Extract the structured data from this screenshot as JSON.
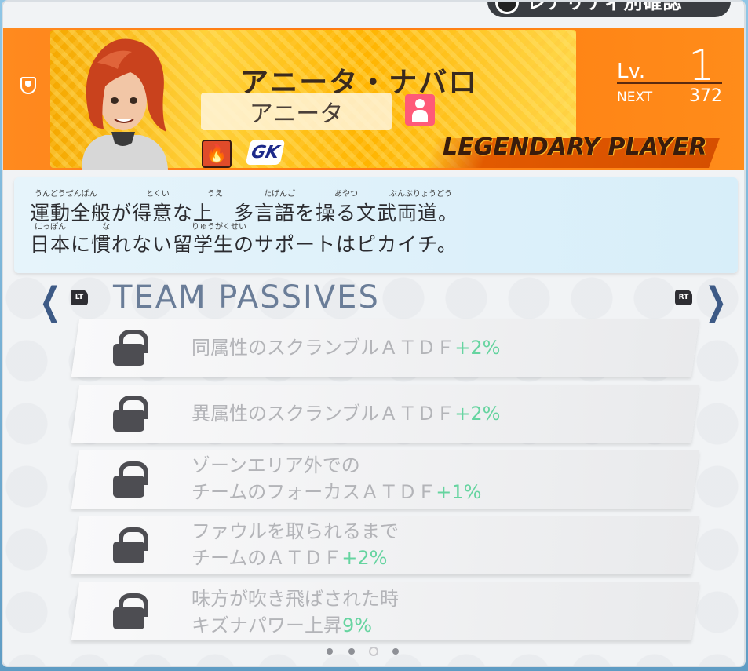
{
  "top_tab": {
    "label": "レアリティ別確認"
  },
  "header": {
    "name": "アニータ・ナバロ",
    "nickname": "アニータ",
    "position": "GK",
    "element_icon": "fire-icon",
    "level_label": "Lv.",
    "level": "1",
    "next_label": "NEXT",
    "next_value": "372",
    "rarity": "LEGENDARY PLAYER"
  },
  "description": {
    "line1": "運動全般が得意な上　多言語を操る文武両道。",
    "line2": "日本に慣れない留学生のサポートはピカイチ。",
    "ruby": [
      "うんどうぜんぱん",
      "とくい",
      "うえ",
      "たげんご",
      "あやつ",
      "ぶんぶりょうどう",
      "にっぽん",
      "な",
      "りゅうがくせい"
    ]
  },
  "passives": {
    "title": "TEAM PASSIVES",
    "left_button": "LT",
    "right_button": "RT",
    "items": [
      {
        "line1": "同属性のスクランブルＡＴＤＦ",
        "line2": "",
        "value": "+2%"
      },
      {
        "line1": "異属性のスクランブルＡＴＤＦ",
        "line2": "",
        "value": "+2%"
      },
      {
        "line1": "ゾーンエリア外での",
        "line2": "チームのフォーカスＡＴＤＦ",
        "value": "+1%"
      },
      {
        "line1": "ファウルを取られるまで",
        "line2": "チームのＡＴＤＦ",
        "value": "+2%"
      },
      {
        "line1": "味方が吹き飛ばされた時",
        "line2": "キズナパワー上昇",
        "value": "9%"
      }
    ]
  },
  "pagination": {
    "count": 4,
    "active": 2
  },
  "colors": {
    "header": "#ff8a1f",
    "accent_value": "#66d4a0",
    "nav": "#3d5a86"
  }
}
